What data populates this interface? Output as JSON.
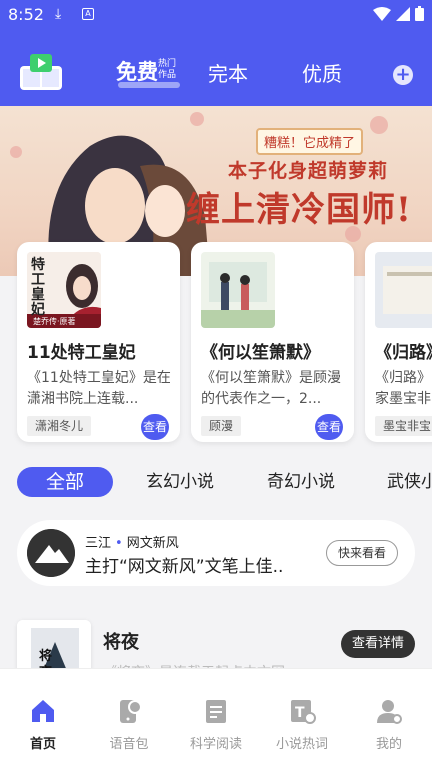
{
  "status_bar": {
    "time": "8:52"
  },
  "header": {
    "tabs": [
      {
        "label": "免费",
        "sup": "热门作品"
      },
      {
        "label": "完本"
      },
      {
        "label": "优质"
      }
    ],
    "plus": "+"
  },
  "banner": {
    "tag": "糟糕！它成精了",
    "subtitle": "本子化身超萌萝莉",
    "headline": "缠上清冷国师!"
  },
  "cards": [
    {
      "title": "11处特工皇妃",
      "desc": "《11处特工皇妃》是在潇湘书院上连载...",
      "author": "潇湘冬儿",
      "button": "查看",
      "cover_text": "特工皇妃",
      "cover_sub": "楚乔传·原著"
    },
    {
      "title": "《何以笙箫默》",
      "desc": "《何以笙箫默》是顾漫的代表作之一，2...",
      "author": "顾漫",
      "button": "查看"
    },
    {
      "title": "《归路》",
      "desc": "《归路》",
      "desc2": "家墨宝非",
      "author": "墨宝非宝"
    }
  ],
  "categories": [
    "全部",
    "玄幻小说",
    "奇幻小说",
    "武侠小"
  ],
  "news": {
    "source": "三江",
    "channel": "网文新风",
    "headline": "主打“网文新风”文笔上佳..",
    "button": "快来看看"
  },
  "item": {
    "name": "将夜",
    "button": "查看详情",
    "ghost": "《将夜》是连载于起点中文网"
  },
  "bottom_nav": [
    {
      "label": "首页",
      "icon": "home-icon"
    },
    {
      "label": "语音包",
      "icon": "voice-pack-icon"
    },
    {
      "label": "科学阅读",
      "icon": "reading-icon"
    },
    {
      "label": "小说热词",
      "icon": "hot-words-icon"
    },
    {
      "label": "我的",
      "icon": "profile-icon"
    }
  ],
  "colors": {
    "accent": "#4f5bf0",
    "dark_button": "#333333"
  }
}
